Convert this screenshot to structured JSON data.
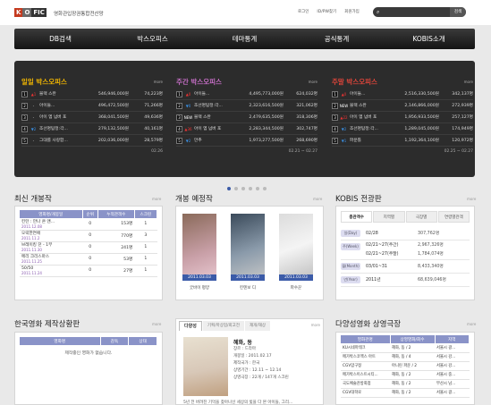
{
  "header": {
    "logo": [
      "K",
      "O",
      "FIC"
    ],
    "site_name": "영화관입장권통합전산망",
    "links": [
      "로그인",
      "ID/PW찾기",
      "회원가입"
    ],
    "search_button": "검색"
  },
  "nav": [
    "DB검색",
    "박스오피스",
    "테마통계",
    "공식통계",
    "KOBIS소개"
  ],
  "boxoffice": [
    {
      "title": "일일 박스오피스",
      "color": "#f5b800",
      "more": "more",
      "date": "02.26",
      "rows": [
        {
          "rank": "1",
          "change": "▲1",
          "cls": "up",
          "name": "블랙 스완",
          "v1": "546,946,000원",
          "v2": "74,223명"
        },
        {
          "rank": "2",
          "change": "-",
          "cls": "eq",
          "name": "아이들...",
          "v1": "496,472,500원",
          "v2": "71,266명"
        },
        {
          "rank": "3",
          "change": "-",
          "cls": "eq",
          "name": "아이 엠 넘버 포",
          "v1": "368,041,500원",
          "v2": "49,636명"
        },
        {
          "rank": "4",
          "change": "▼2",
          "cls": "dn",
          "name": "조선명탐정:각...",
          "v1": "279,132,500원",
          "v2": "40,161명"
        },
        {
          "rank": "5",
          "change": "-",
          "cls": "eq",
          "name": "그대를 사랑합...",
          "v1": "202,036,000원",
          "v2": "28,579명"
        }
      ]
    },
    {
      "title": "주간 박스오피스",
      "color": "#c86fc8",
      "more": "more",
      "date": "02.21 ~ 02.27",
      "rows": [
        {
          "rank": "1",
          "change": "▲0",
          "cls": "up",
          "name": "아이들...",
          "v1": "4,495,773,000원",
          "v2": "624,032명"
        },
        {
          "rank": "2",
          "change": "▼0",
          "cls": "dn",
          "name": "조선명탐정:각...",
          "v1": "2,323,616,500원",
          "v2": "321,062명"
        },
        {
          "rank": "3",
          "change": "NEW",
          "cls": "nw",
          "name": "블랙 스완",
          "v1": "2,479,635,500원",
          "v2": "318,306명"
        },
        {
          "rank": "4",
          "change": "▲36",
          "cls": "up",
          "name": "아이 엠 넘버 포",
          "v1": "2,283,344,500원",
          "v2": "302,747명"
        },
        {
          "rank": "5",
          "change": "▼2",
          "cls": "dn",
          "name": "만추",
          "v1": "1,973,277,500원",
          "v2": "268,690명"
        }
      ]
    },
    {
      "title": "주말 박스오피스",
      "color": "#e0453a",
      "more": "more",
      "date": "02.25 ~ 02.27",
      "rows": [
        {
          "rank": "1",
          "change": "▲0",
          "cls": "up",
          "name": "아이들...",
          "v1": "2,516,330,500원",
          "v2": "342,137명"
        },
        {
          "rank": "2",
          "change": "NEW",
          "cls": "nw",
          "name": "블랙 스완",
          "v1": "2,146,866,000원",
          "v2": "272,939명"
        },
        {
          "rank": "3",
          "change": "▲22",
          "cls": "up",
          "name": "아이 엠 넘버 포",
          "v1": "1,956,933,500원",
          "v2": "257,127명"
        },
        {
          "rank": "4",
          "change": "▼2",
          "cls": "dn",
          "name": "조선명탐정:각...",
          "v1": "1,289,045,000원",
          "v2": "174,949명"
        },
        {
          "rank": "5",
          "change": "▼1",
          "cls": "dn",
          "name": "파운틀",
          "v1": "1,192,364,100원",
          "v2": "120,972명"
        }
      ]
    }
  ],
  "new_films": {
    "title": "최신 개봉작",
    "more": "more",
    "headers": [
      "영화명/개봉일",
      "순위",
      "누적관객수",
      "스크린"
    ],
    "rows": [
      {
        "name": "킨턴 : 만나 온 앤...",
        "date": "2011.12.08",
        "rank": "0",
        "aud": "153명",
        "scr": "1"
      },
      {
        "name": "오락한연애",
        "date": "2011.11.2",
        "rank": "0",
        "aud": "770명",
        "scr": "3"
      },
      {
        "name": "브레이킹 던 - 1부",
        "date": "2011.11.30",
        "rank": "0",
        "aud": "241명",
        "scr": "1"
      },
      {
        "name": "메리 크리스마스",
        "date": "2011.11.25",
        "rank": "0",
        "aud": "53명",
        "scr": "1"
      },
      {
        "name": "50/50",
        "date": "2011.11.24",
        "rank": "0",
        "aud": "27명",
        "scr": "1"
      }
    ]
  },
  "upcoming": {
    "title": "개봉 예정작",
    "more": "more",
    "items": [
      {
        "date": "2011.03.03",
        "name": "굿바이 평양"
      },
      {
        "date": "2011.03.03",
        "name": "킨텐보 디"
      },
      {
        "date": "2011.03.03",
        "name": "파수꾼"
      }
    ]
  },
  "kobis": {
    "title": "KOBIS 전광판",
    "more": "more",
    "tabs": [
      "총관객수",
      "지역별",
      "극장별",
      "연령별관객"
    ],
    "rows": [
      {
        "label": "일(Day)",
        "d": "02/28",
        "v": "307,762명"
      },
      {
        "label": "주(Week)",
        "d": "02/21~27(주간)",
        "v": "2,967,326명",
        "d2": "02/21~27(주말)",
        "v2": "1,784,074명"
      },
      {
        "label": "월(Month)",
        "d": "03/01~31",
        "v": "8,433,340명"
      },
      {
        "label": "년(Year)",
        "d": "2011년",
        "v": "68,639,046명"
      }
    ]
  },
  "production": {
    "title": "한국영화 제작상황판",
    "more": "more",
    "headers": [
      "영화명",
      "감독",
      "상태"
    ],
    "empty": "제작중인 영화가 없습니다."
  },
  "detail": {
    "tabs": [
      "다양성",
      "기획/마상업/회고전",
      "재개/재상"
    ],
    "more": "more",
    "name": "혜화, 동",
    "lines": [
      "장르 : 드라마",
      "개봉일 : 2011.02.17",
      "제작국가 : 한국",
      "상영기간 : 12.11 ~ 12.14",
      "상영극장 : 22개 / 147개 스크린"
    ],
    "synopsis": "5년 전 버려진 기억을 찾아나선 세상의 빛을 다 본 아이들, 그리..."
  },
  "theaters": {
    "title": "다양성영화 상영극장",
    "more": "more",
    "headers": [
      "영화관명",
      "상영영화/회수",
      "지역"
    ],
    "rows": [
      {
        "n": "KU시네마테크",
        "m": "혜화, 동 / 2",
        "r": "서울시 광..."
      },
      {
        "n": "메가박스코엑스 아트",
        "m": "혜화, 동 / 4",
        "r": "서울시 강..."
      },
      {
        "n": "CGV압구정",
        "m": "아니린 파운 / 2",
        "r": "서울시 강..."
      },
      {
        "n": "메가박스이스트시티...",
        "m": "혜화, 동 / 2",
        "r": "서울시 중..."
      },
      {
        "n": "국도예술관방화점",
        "m": "혜화, 동 / 2",
        "r": "부산시 남..."
      },
      {
        "n": "CGV대학로",
        "m": "혜화, 동 / 2",
        "r": "서울시 광..."
      }
    ]
  }
}
